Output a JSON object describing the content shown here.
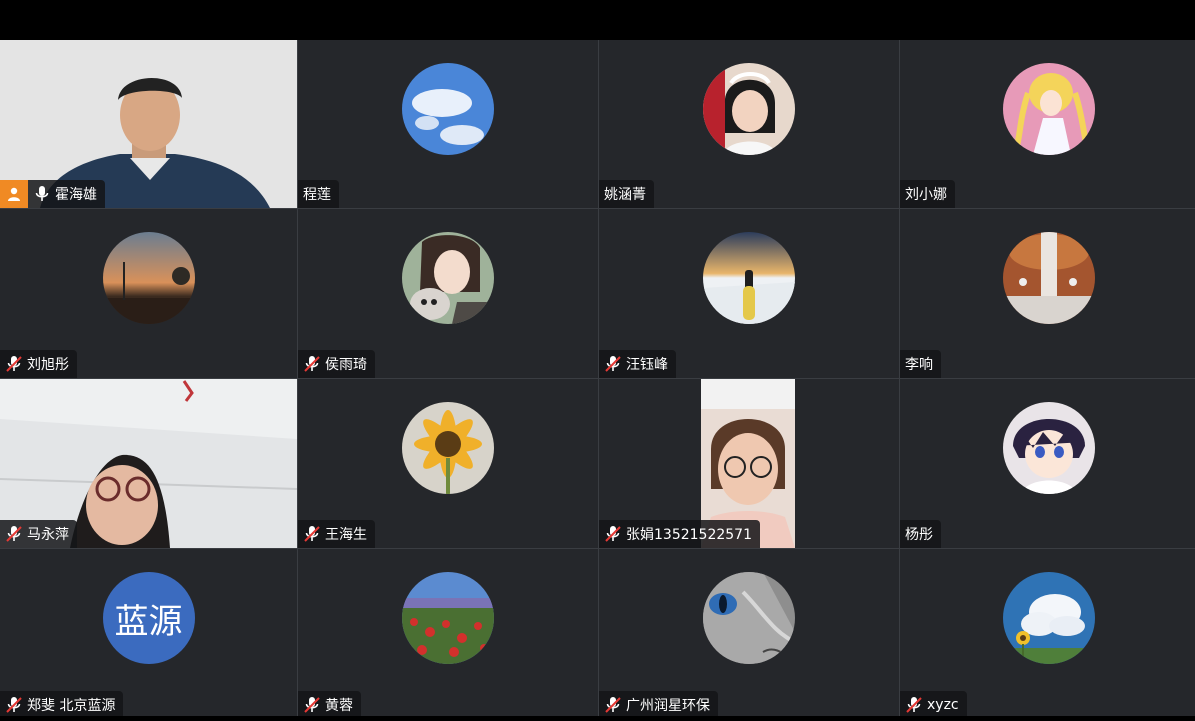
{
  "participants": [
    {
      "name": "霍海雄",
      "mic": "on",
      "host": true,
      "video": true
    },
    {
      "name": "程莲",
      "mic": "none"
    },
    {
      "name": "姚涵菁",
      "mic": "none"
    },
    {
      "name": "刘小娜",
      "mic": "none"
    },
    {
      "name": "刘旭彤",
      "mic": "muted"
    },
    {
      "name": "侯雨琦",
      "mic": "muted"
    },
    {
      "name": "汪钰峰",
      "mic": "muted"
    },
    {
      "name": "李响",
      "mic": "none"
    },
    {
      "name": "马永萍",
      "mic": "muted",
      "video": true
    },
    {
      "name": "王海生",
      "mic": "muted"
    },
    {
      "name": "张娟13521522571",
      "mic": "muted",
      "video": true
    },
    {
      "name": "杨彤",
      "mic": "none"
    },
    {
      "name": "郑斐 北京蓝源",
      "mic": "muted",
      "avatar_text": "蓝源"
    },
    {
      "name": "黄蓉",
      "mic": "muted"
    },
    {
      "name": "广州润星环保",
      "mic": "muted"
    },
    {
      "name": "xyzc",
      "mic": "muted"
    }
  ],
  "colors": {
    "tile_bg": "#25272b",
    "host_badge": "#f08a24",
    "lanyuan_avatar": "#3b6bbf"
  },
  "icons": {
    "mic_on": "microphone-icon",
    "mic_muted": "microphone-muted-icon",
    "host": "host-person-icon"
  }
}
